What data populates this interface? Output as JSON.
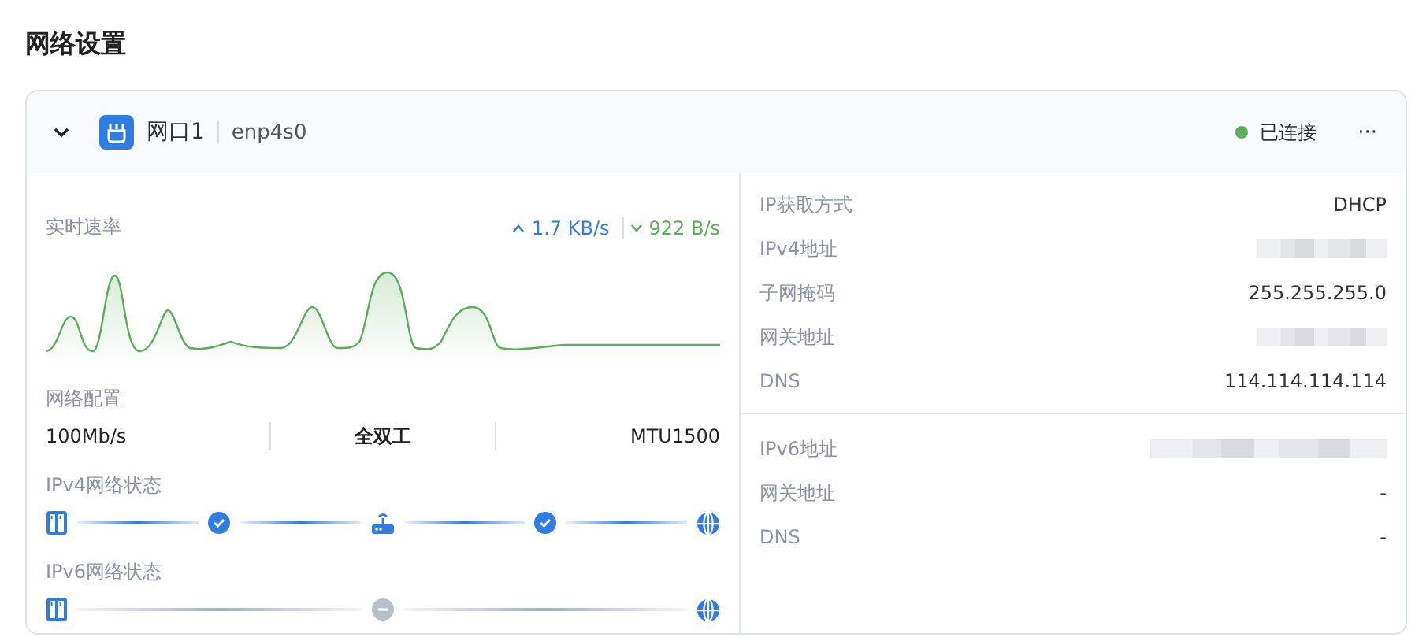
{
  "page_title": "网络设置",
  "interface": {
    "expanded": true,
    "name": "网口1",
    "device": "enp4s0",
    "status": {
      "text": "已连接",
      "color": "#5aad5a"
    },
    "menu": "···"
  },
  "speed": {
    "label": "实时速率",
    "upload": "1.7 KB/s",
    "download": "922 B/s"
  },
  "config": {
    "label": "网络配置",
    "values": [
      "100Mb/s",
      "全双工",
      "MTU1500"
    ]
  },
  "status_rows": [
    {
      "label": "IPv4网络状态",
      "connected": true,
      "nodes": [
        {
          "kind": "device"
        },
        {
          "kind": "check"
        },
        {
          "kind": "router"
        },
        {
          "kind": "check"
        },
        {
          "kind": "globe"
        }
      ]
    },
    {
      "label": "IPv6网络状态",
      "connected": false,
      "nodes": [
        {
          "kind": "device"
        },
        {
          "kind": "pending"
        },
        {
          "kind": "globe"
        }
      ]
    }
  ],
  "ipv4": [
    {
      "label": "IP获取方式",
      "kind": "text",
      "value": "DHCP"
    },
    {
      "label": "IPv4地址",
      "kind": "redacted"
    },
    {
      "label": "子网掩码",
      "kind": "text",
      "value": "255.255.255.0"
    },
    {
      "label": "网关地址",
      "kind": "redacted"
    },
    {
      "label": "DNS",
      "kind": "text",
      "value": "114.114.114.114"
    }
  ],
  "ipv6": [
    {
      "label": "IPv6地址",
      "kind": "redacted"
    },
    {
      "label": "网关地址",
      "kind": "text",
      "value": "-"
    },
    {
      "label": "DNS",
      "kind": "text",
      "value": "-"
    }
  ]
}
